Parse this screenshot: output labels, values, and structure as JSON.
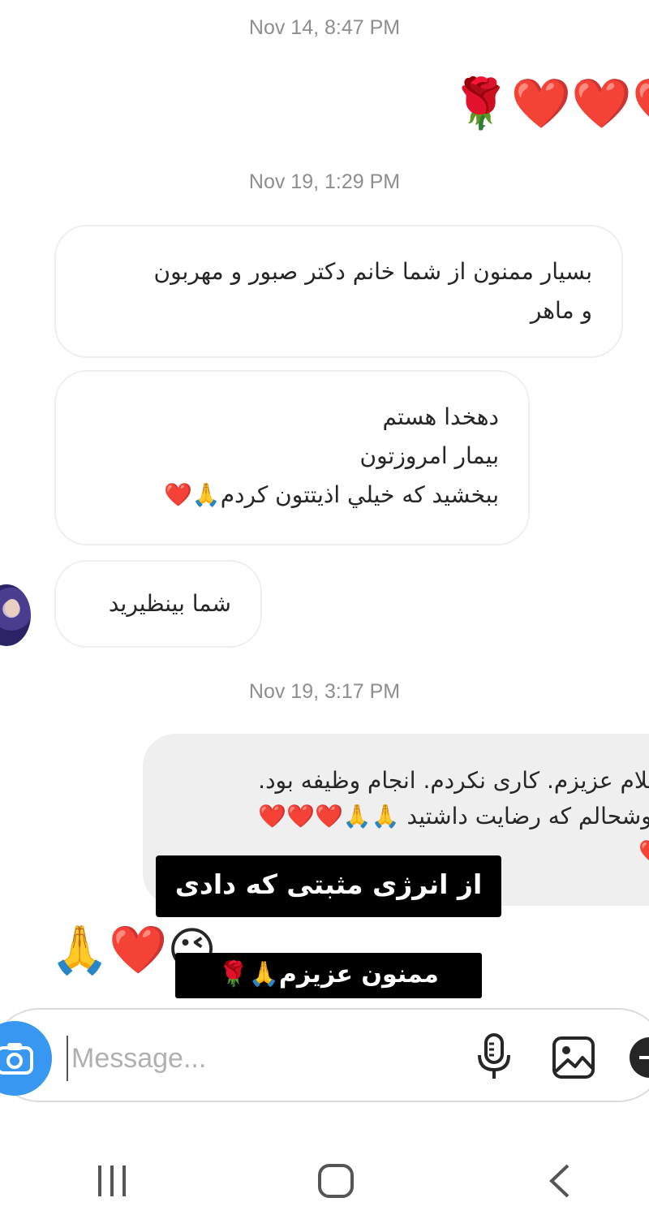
{
  "timestamps": [
    "Nov 14, 8:47 PM",
    "Nov 19, 1:29 PM",
    "Nov 19, 3:17 PM"
  ],
  "sent_emoji_message": "🌹❤️❤️❤️",
  "received_messages": [
    {
      "lines": [
        "بسيار ممنون از شما خانم دکتر صبور و مهربون",
        "و ماهر"
      ]
    },
    {
      "lines": [
        "دهخدا هستم",
        "بيمار امروزتون",
        "ببخشيد که خيلي اذيتتون کردم🙏❤️"
      ]
    },
    {
      "lines": [
        "شما بينظيريد"
      ]
    }
  ],
  "sent_reply": {
    "lines": [
      "سلام عزیزم. کاری نکردم. انجام وظیفه بود.",
      "خوشحالم که رضایت داشتید 🙏🙏❤️❤️❤️",
      "❤️"
    ]
  },
  "captions": {
    "caption_1": "از انرژی مثبتی که دادی",
    "caption_2": "ممنون عزیزم🙏🌹"
  },
  "reaction_emoji": "🙏❤️😉",
  "composer": {
    "placeholder": "Message...",
    "icons": [
      "camera-icon",
      "microphone-icon",
      "gallery-icon",
      "add-icon"
    ]
  },
  "colors": {
    "accent": "#3897f0",
    "bubble_border": "#efefef",
    "sent_bubble_bg": "#efefef",
    "timestamp": "#8e8e8e"
  },
  "navigation": {
    "icons": [
      "recent-apps-icon",
      "home-icon",
      "back-icon"
    ]
  }
}
